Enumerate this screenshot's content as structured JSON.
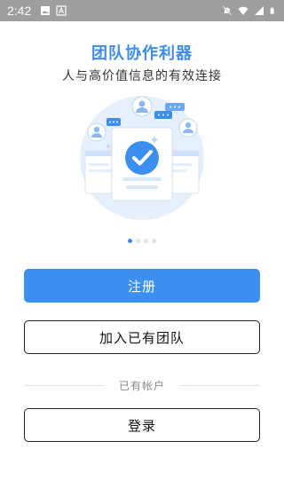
{
  "status_bar": {
    "time": "2:42",
    "left_icons": [
      "image-icon",
      "a-icon"
    ],
    "right_icons": [
      "bell-off-icon",
      "wifi-icon",
      "signal-icon",
      "battery-icon"
    ]
  },
  "header": {
    "title": "团队协作利器",
    "subtitle": "人与高价值信息的有效连接"
  },
  "carousel": {
    "count": 4,
    "active_index": 0
  },
  "actions": {
    "register_label": "注册",
    "join_team_label": "加入已有团队",
    "divider_label": "已有帐户",
    "login_label": "登录"
  },
  "colors": {
    "accent": "#3a8ff0",
    "status_bar": "#9e9e9e"
  }
}
